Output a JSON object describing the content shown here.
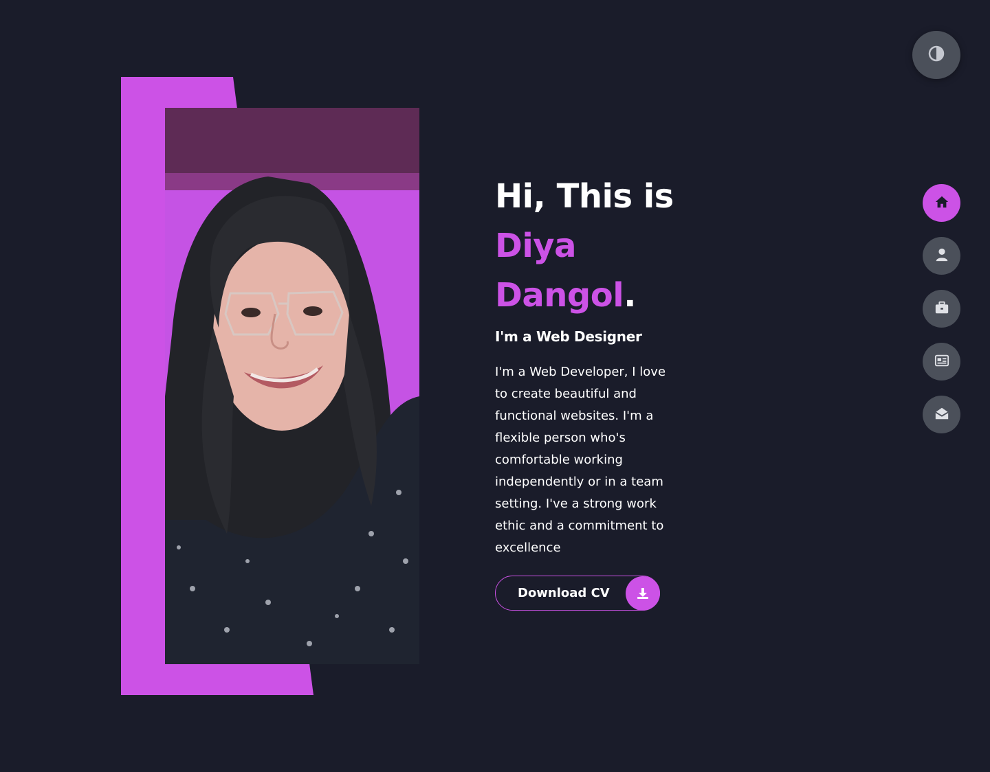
{
  "theme_toggle": {
    "icon": "contrast-icon"
  },
  "nav": {
    "items": [
      {
        "name": "home",
        "icon": "home-icon",
        "active": true
      },
      {
        "name": "about",
        "icon": "user-icon",
        "active": false
      },
      {
        "name": "portfolio",
        "icon": "briefcase-icon",
        "active": false
      },
      {
        "name": "blog",
        "icon": "newspaper-icon",
        "active": false
      },
      {
        "name": "contact",
        "icon": "envelope-open-icon",
        "active": false
      }
    ]
  },
  "hero": {
    "greeting": "Hi, This is",
    "first_name": "Diya",
    "last_name": "Dangol",
    "period": ".",
    "role": "I'm a Web Designer",
    "bio": "I'm a Web Developer, I love to create beautiful and functional websites. I'm a flexible person who's comfortable working independently or in a team setting. I've a strong work ethic and a commitment to excellence",
    "cv_button_label": "Download CV",
    "cv_button_icon": "download-icon"
  },
  "colors": {
    "accent": "#cc52e6",
    "background": "#1a1c2a",
    "nav_inactive": "#4b505a"
  }
}
